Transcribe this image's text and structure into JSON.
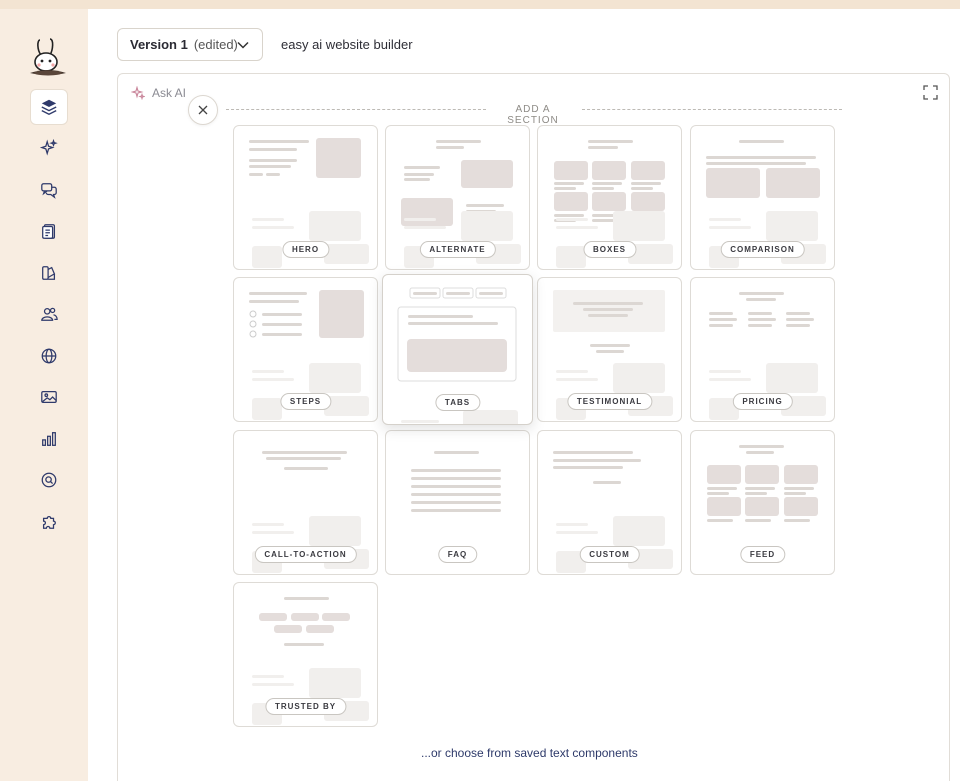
{
  "sidebar": {
    "logo": "bunny-logo",
    "items": [
      {
        "name": "layers",
        "icon": "layers-icon",
        "active": true
      },
      {
        "name": "ai",
        "icon": "sparkles-icon"
      },
      {
        "name": "chat",
        "icon": "chat-icon"
      },
      {
        "name": "pages",
        "icon": "clipboard-icon"
      },
      {
        "name": "design",
        "icon": "palette-icon"
      },
      {
        "name": "users",
        "icon": "users-icon"
      },
      {
        "name": "globe",
        "icon": "globe-icon"
      },
      {
        "name": "images",
        "icon": "image-icon"
      },
      {
        "name": "analytics",
        "icon": "bar-chart-icon"
      },
      {
        "name": "seo",
        "icon": "search-icon"
      },
      {
        "name": "integrations",
        "icon": "puzzle-icon"
      }
    ]
  },
  "header": {
    "version_label": "Version 1",
    "version_state": "(edited)",
    "project_title": "easy ai website builder"
  },
  "canvas": {
    "ask_ai_label": "Ask AI",
    "add_section_label": "ADD A SECTION",
    "saved_components_link": "...or choose from saved text components"
  },
  "sections": [
    {
      "label": "HERO",
      "kind": "hero"
    },
    {
      "label": "ALTERNATE",
      "kind": "alternate"
    },
    {
      "label": "BOXES",
      "kind": "boxes"
    },
    {
      "label": "COMPARISON",
      "kind": "comparison"
    },
    {
      "label": "STEPS",
      "kind": "steps"
    },
    {
      "label": "TABS",
      "kind": "tabs"
    },
    {
      "label": "TESTIMONIAL",
      "kind": "testimonial"
    },
    {
      "label": "PRICING",
      "kind": "pricing"
    },
    {
      "label": "CALL-TO-ACTION",
      "kind": "cta"
    },
    {
      "label": "FAQ",
      "kind": "faq"
    },
    {
      "label": "CUSTOM",
      "kind": "custom"
    },
    {
      "label": "FEED",
      "kind": "feed"
    },
    {
      "label": "TRUSTED BY",
      "kind": "trusted"
    }
  ],
  "colors": {
    "page_bg": "#f5e9dc",
    "placeholder_block": "#e4dddb",
    "placeholder_line": "#dcd7d3",
    "link": "#2e3a6a"
  }
}
